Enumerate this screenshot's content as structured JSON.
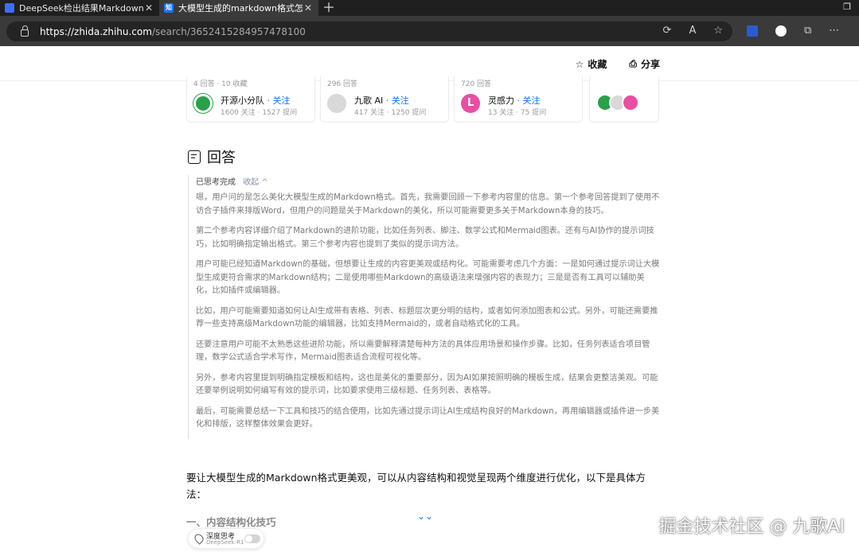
{
  "browser": {
    "tabs": [
      {
        "title": "DeepSeek检出结果Markdown格式",
        "active": false
      },
      {
        "title": "大模型生成的markdown格式怎么",
        "active": true
      }
    ],
    "url_host": "https://zhida.zhihu.com",
    "url_path": "/search/3652415284957478100"
  },
  "topnav": {
    "favorite_label": "收藏",
    "share_label": "分享"
  },
  "cards": [
    {
      "meta": "4 回答 · 10 收藏",
      "name": "开源小分队",
      "follow": "· 关注",
      "stats": "1600 关注 · 1527 提问"
    },
    {
      "meta": "296 回答",
      "name": "九歌 AI",
      "follow": "· 关注",
      "stats": "417 关注 · 1250 提问"
    },
    {
      "meta": "720 回答",
      "name": "灵感力",
      "follow": "· 关注",
      "stats": "13 关注 · 75 提问"
    }
  ],
  "section_title": "回答",
  "thinking": {
    "status": "已思考完成",
    "collapse": "收起 ^",
    "paragraphs": [
      "嗯，用户问的是怎么美化大模型生成的Markdown格式。首先，我需要回顾一下参考内容里的信息。第一个参考回答提到了使用不访合子插件来排版Word，但用户的问题是关于Markdown的美化，所以可能需要更多关于Markdown本身的技巧。",
      "第二个参考内容详细介绍了Markdown的进阶功能，比如任务列表、脚注、数学公式和Mermaid图表。还有与AI协作的提示词技巧，比如明确指定输出格式。第三个参考内容也提到了类似的提示词方法。",
      "用户可能已经知道Markdown的基础，但想要让生成的内容更美观或结构化。可能需要考虑几个方面：一是如何通过提示词让大模型生成更符合需求的Markdown结构；二是使用哪些Markdown的高级语法来增强内容的表现力；三是是否有工具可以辅助美化，比如插件或编辑器。",
      "比如，用户可能需要知道如何让AI生成带有表格、列表、标题层次更分明的结构，或者如何添加图表和公式。另外，可能还需要推荐一些支持高级Markdown功能的编辑器，比如支持Mermaid的，或者自动格式化的工具。",
      "还要注意用户可能不太熟悉这些进阶功能，所以需要解释清楚每种方法的具体应用场景和操作步骤。比如，任务列表适合项目管理，数学公式适合学术写作，Mermaid图表适合流程可视化等。",
      "另外，参考内容里提到明确指定模板和结构，这也是美化的重要部分，因为AI如果按照明确的模板生成，结果会更整洁美观。可能还要举例说明如何编写有效的提示词，比如要求使用三级标题、任务列表、表格等。",
      "最后，可能需要总结一下工具和技巧的结合使用，比如先通过提示词让AI生成结构良好的Markdown，再用编辑器或插件进一步美化和排版，这样整体效果会更好。"
    ]
  },
  "answer_text": "要让大模型生成的Markdown格式更美观，可以从内容结构和视觉呈现两个维度进行优化，以下是具体方法：",
  "subheading": "一、内容结构化技巧",
  "pill": {
    "label": "深度思考",
    "sub": "DeepSeek-R1"
  },
  "watermark": "掘金技术社区 @ 九歌AI"
}
